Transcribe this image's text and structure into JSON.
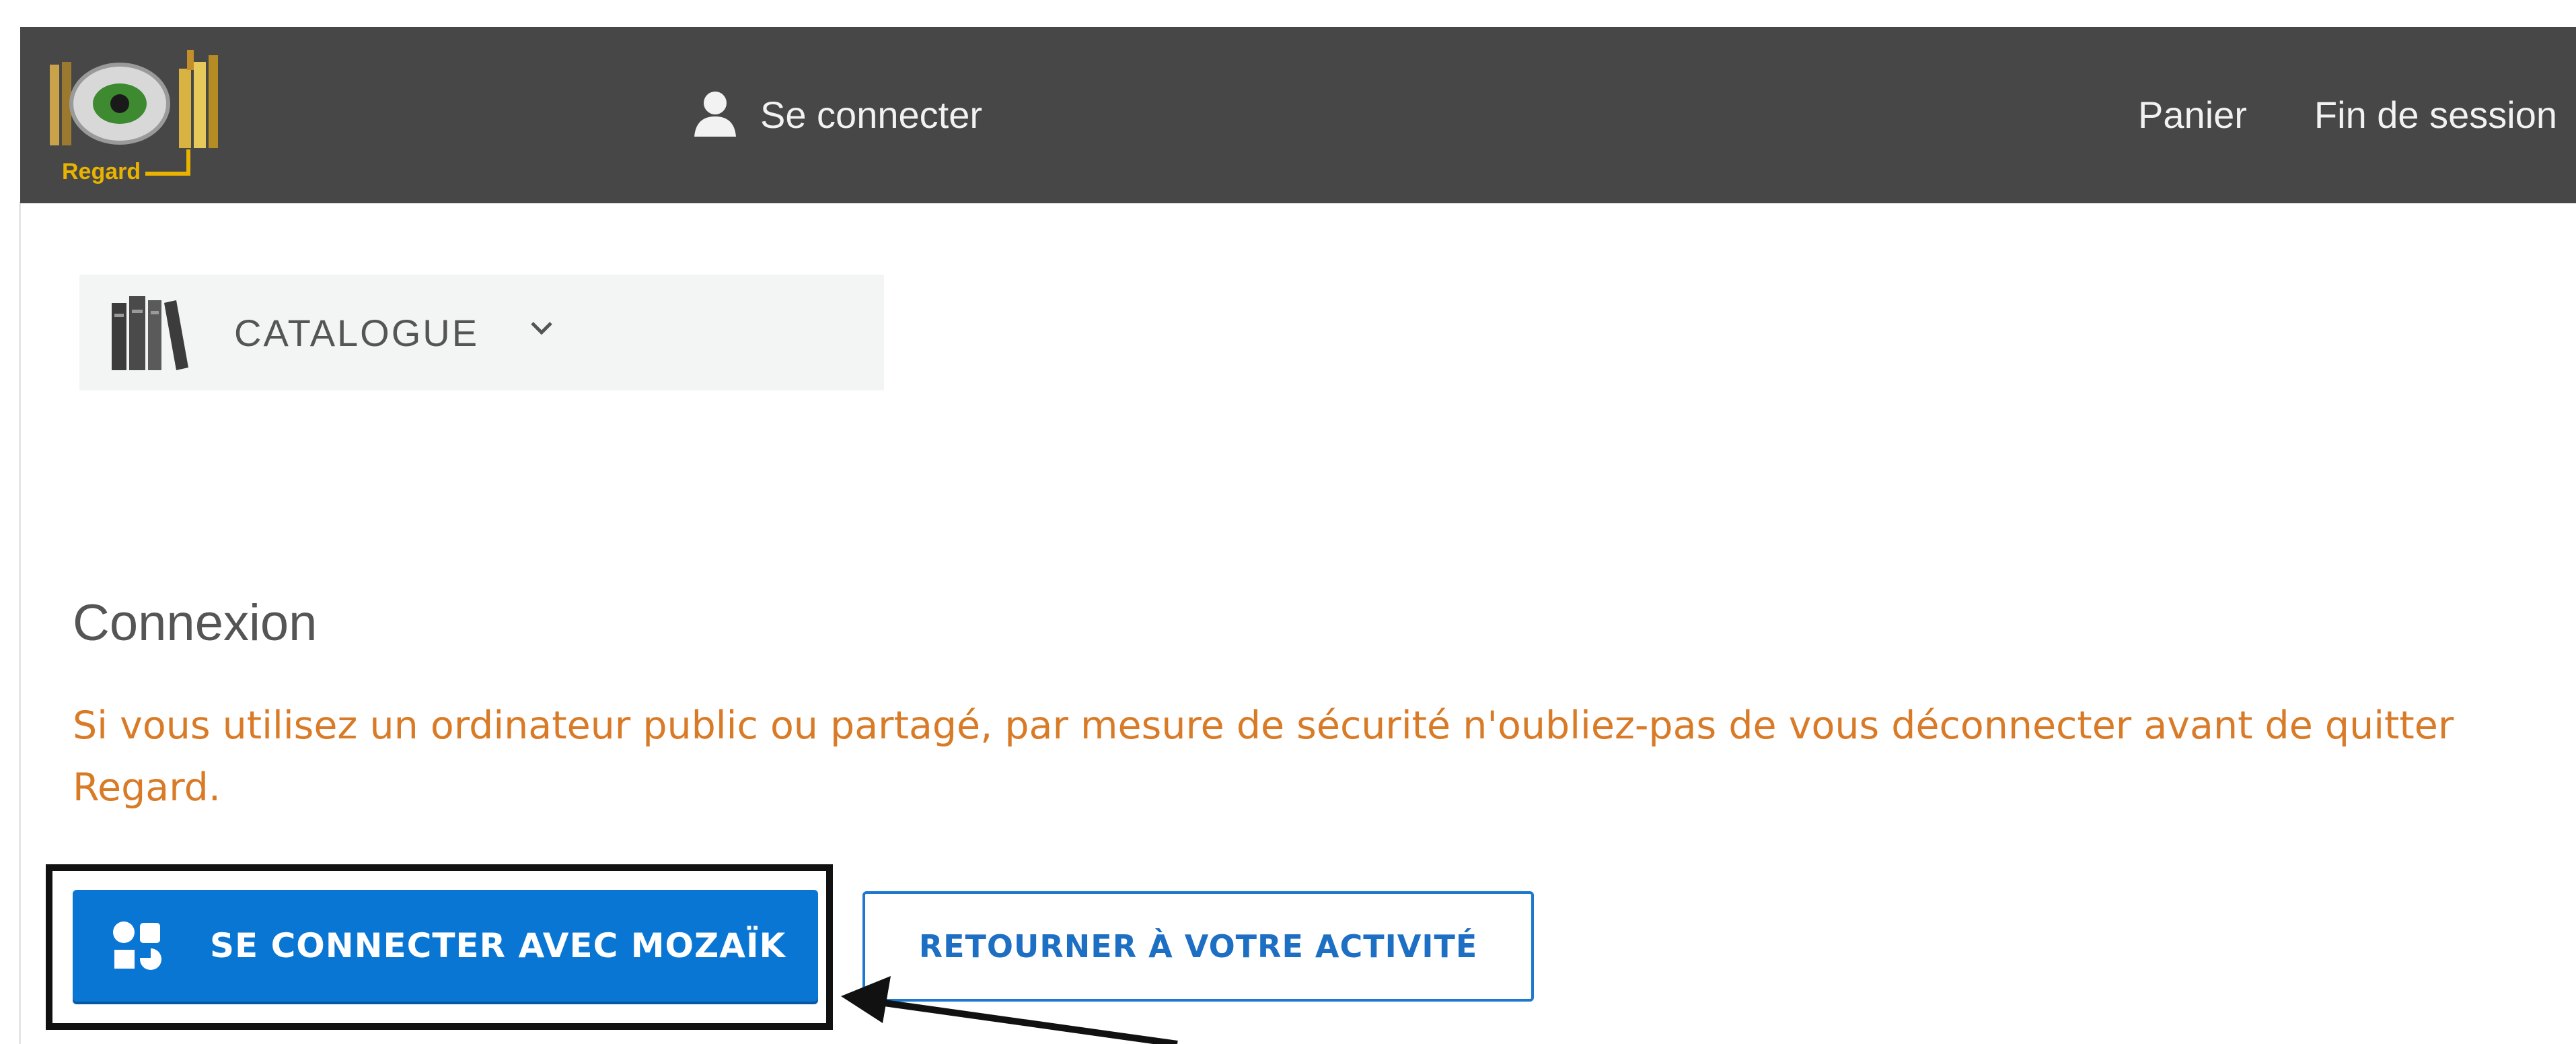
{
  "header": {
    "logo_text": "Regard",
    "login_label": "Se connecter",
    "nav": {
      "cart_label": "Panier",
      "end_session_label": "Fin de session"
    }
  },
  "catalogue": {
    "label": "CATALOGUE"
  },
  "main": {
    "heading": "Connexion",
    "warning": "Si vous utilisez un ordinateur public ou partagé, par mesure de sécurité n'oubliez-pas de vous déconnecter avant de quitter Regard.",
    "primary_button_label": "SE CONNECTER AVEC MOZAÏK",
    "secondary_button_label": "RETOURNER À VOTRE ACTIVITÉ"
  },
  "icons": {
    "logo": "regard-logo-icon",
    "user": "user-icon",
    "books": "books-icon",
    "chevron": "chevron-down-icon",
    "mozaik": "mozaik-icon",
    "annotation": "annotation-arrow"
  },
  "colors": {
    "header_bg": "#474747",
    "warning_text": "#d97a26",
    "primary_button": "#0a76d4",
    "secondary_border": "#1d78d0",
    "highlight_border": "#111111"
  }
}
